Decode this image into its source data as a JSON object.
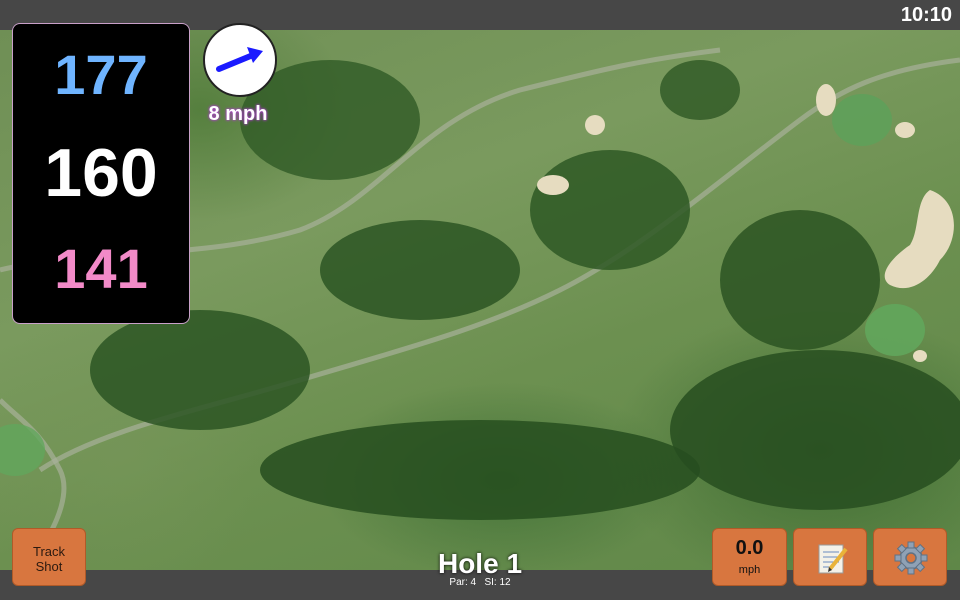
{
  "status": {
    "time": "10:10"
  },
  "yardage": {
    "back": "177",
    "middle": "160",
    "front": "141"
  },
  "wind": {
    "speed_label": "8 mph",
    "direction_icon": "arrow-icon"
  },
  "buttons": {
    "track_shot_label": "Track\nShot",
    "speed_value": "0.0",
    "speed_unit": "mph",
    "notes_icon": "notepad-icon",
    "settings_icon": "gear-icon"
  },
  "hole": {
    "title": "Hole 1",
    "par": "Par: 4",
    "si": "SI: 12"
  },
  "colors": {
    "back": "#6fb4ff",
    "middle": "#ffffff",
    "front": "#f28ac8",
    "button": "#d8763f",
    "wind_arrow": "#1a1aff"
  }
}
